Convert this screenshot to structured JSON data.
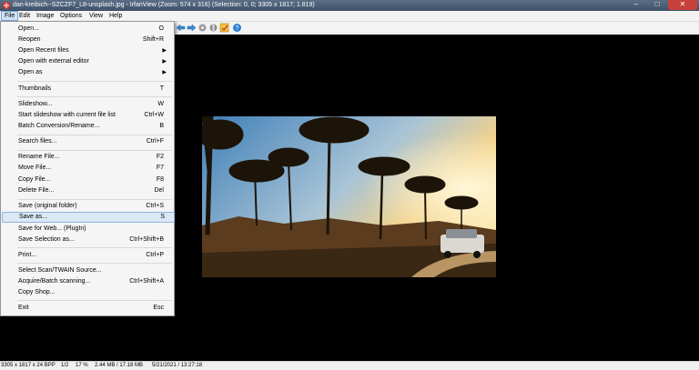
{
  "window": {
    "title": "dan-kreibich--SZCZF7_L8-unsplash.jpg - IrfanView (Zoom: 574 x 316) (Selection: 0, 0; 3305 x 1817; 1.819)",
    "minimize": "–",
    "maximize": "□",
    "close": "✕"
  },
  "menubar": [
    "File",
    "Edit",
    "Image",
    "Options",
    "View",
    "Help"
  ],
  "toolbar_icons": [
    "arrow-left-icon",
    "arrow-right-icon",
    "settings-icon",
    "toggle-icon",
    "paint-icon",
    "help-icon"
  ],
  "file_menu": [
    {
      "label": "Open...",
      "shortcut": "O"
    },
    {
      "label": "Reopen",
      "shortcut": "Shift+R"
    },
    {
      "label": "Open Recent files",
      "shortcut": "",
      "submenu": true
    },
    {
      "label": "Open with external editor",
      "shortcut": "",
      "submenu": true
    },
    {
      "label": "Open as",
      "shortcut": "",
      "submenu": true
    },
    {
      "label": "Thumbnails",
      "shortcut": "T"
    },
    {
      "label": "Slideshow...",
      "shortcut": "W"
    },
    {
      "label": "Start slideshow with current file list",
      "shortcut": "Ctrl+W"
    },
    {
      "label": "Batch Conversion/Rename...",
      "shortcut": "B"
    },
    {
      "label": "Search files...",
      "shortcut": "Ctrl+F"
    },
    {
      "label": "Rename File...",
      "shortcut": "F2"
    },
    {
      "label": "Move File...",
      "shortcut": "F7"
    },
    {
      "label": "Copy File...",
      "shortcut": "F8"
    },
    {
      "label": "Delete File...",
      "shortcut": "Del"
    },
    {
      "label": "Save (original folder)",
      "shortcut": "Ctrl+S"
    },
    {
      "label": "Save as...",
      "shortcut": "S",
      "highlighted": true
    },
    {
      "label": "Save for Web... (PlugIn)",
      "shortcut": ""
    },
    {
      "label": "Save Selection as...",
      "shortcut": "Ctrl+Shift+B"
    },
    {
      "label": "Print...",
      "shortcut": "Ctrl+P"
    },
    {
      "label": "Select Scan/TWAIN Source...",
      "shortcut": ""
    },
    {
      "label": "Acquire/Batch scanning...",
      "shortcut": "Ctrl+Shift+A"
    },
    {
      "label": "Copy Shop...",
      "shortcut": ""
    },
    {
      "label": "Exit",
      "shortcut": "Esc"
    }
  ],
  "statusbar": {
    "dimensions": "3305 x 1817 x 24 BPP",
    "index": "1/2",
    "zoom": "17 %",
    "size": "2.44 MB / 17.18 MB",
    "datetime": "5/21/2021 / 13:27:18"
  },
  "colors": {
    "titlebar": "#4b5f77",
    "menu_highlight": "#dbe9f7",
    "close_button": "#c8403a",
    "viewer_background": "#000000"
  }
}
